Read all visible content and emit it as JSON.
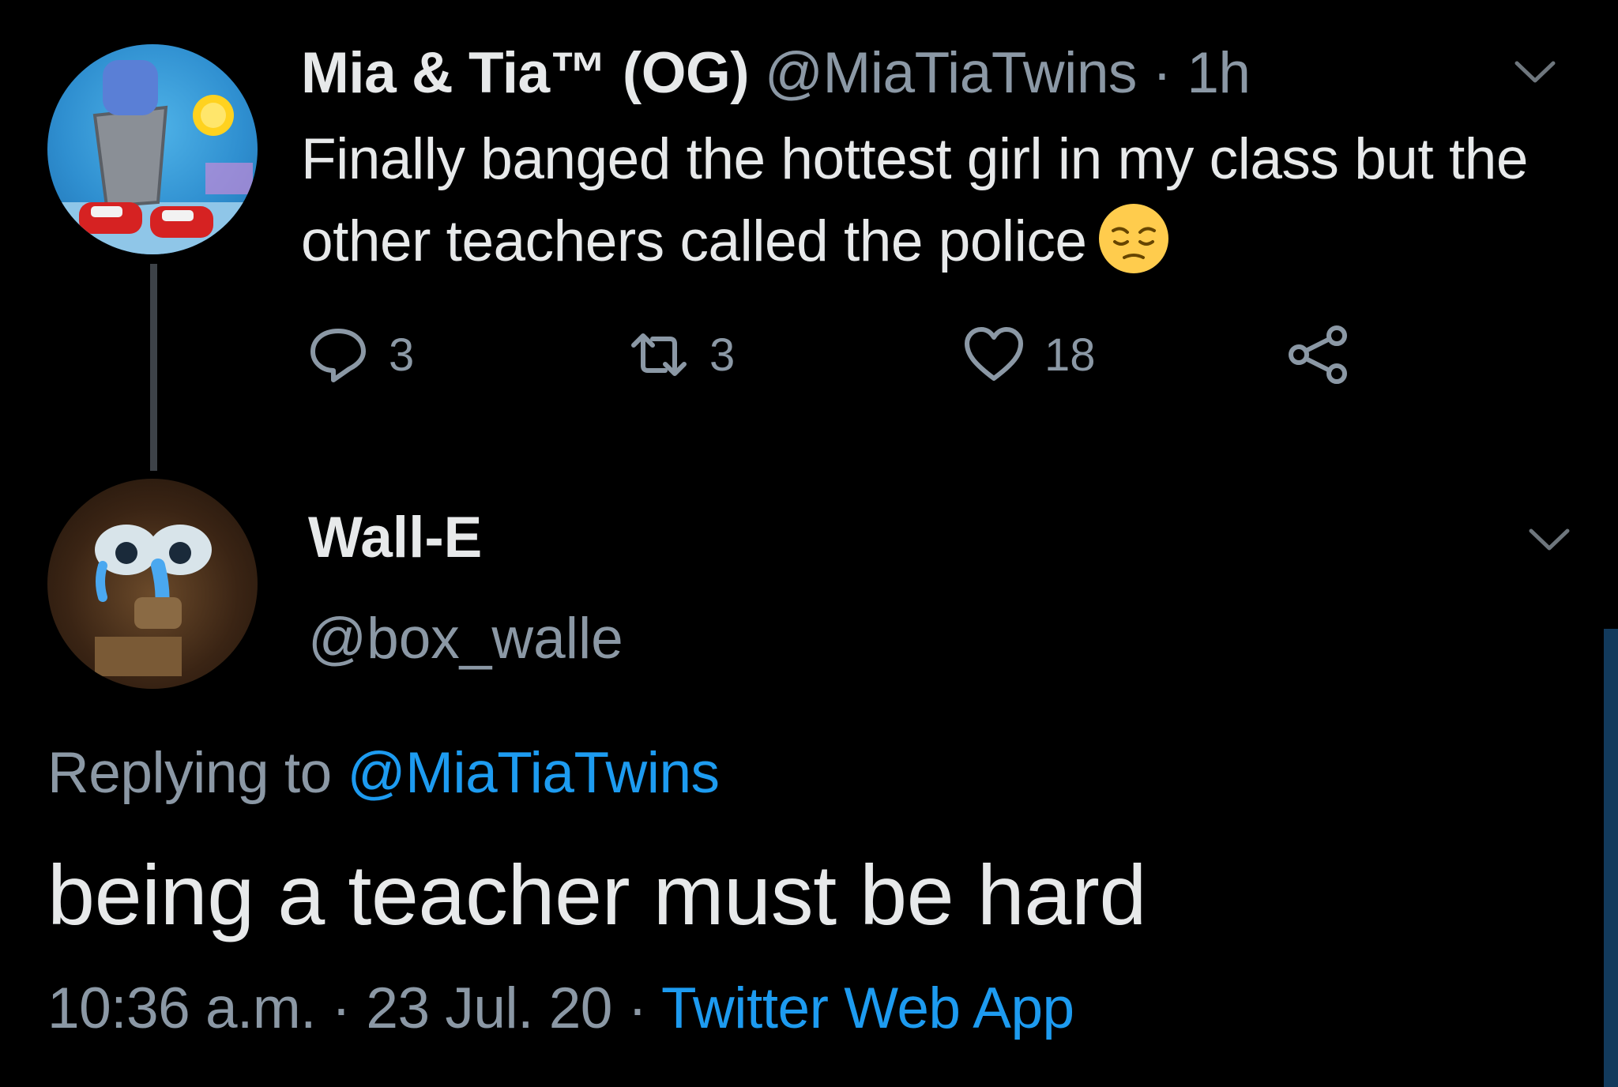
{
  "tweet": {
    "display_name": "Mia & Tia™ (OG)",
    "handle": "@MiaTiaTwins",
    "separator": "·",
    "time": "1h",
    "text": "Finally banged the hottest girl in my class but the other teachers called the police",
    "emoji": "pensive-face-emoji",
    "actions": {
      "reply_count": "3",
      "retweet_count": "3",
      "like_count": "18"
    }
  },
  "reply": {
    "display_name": "Wall-E",
    "handle": "@box_walle",
    "replying_prefix": "Replying to",
    "replying_mention": "@MiaTiaTwins",
    "text": "being a teacher must be hard",
    "time": "10:36 a.m.",
    "separator": "·",
    "date": "23 Jul. 20",
    "separator2": "·",
    "source": "Twitter Web App"
  },
  "colors": {
    "background": "#000000",
    "text_primary": "#e7e9ea",
    "text_secondary": "#8b98a5",
    "link": "#1d9bf0",
    "thread_line": "#3d4248"
  }
}
